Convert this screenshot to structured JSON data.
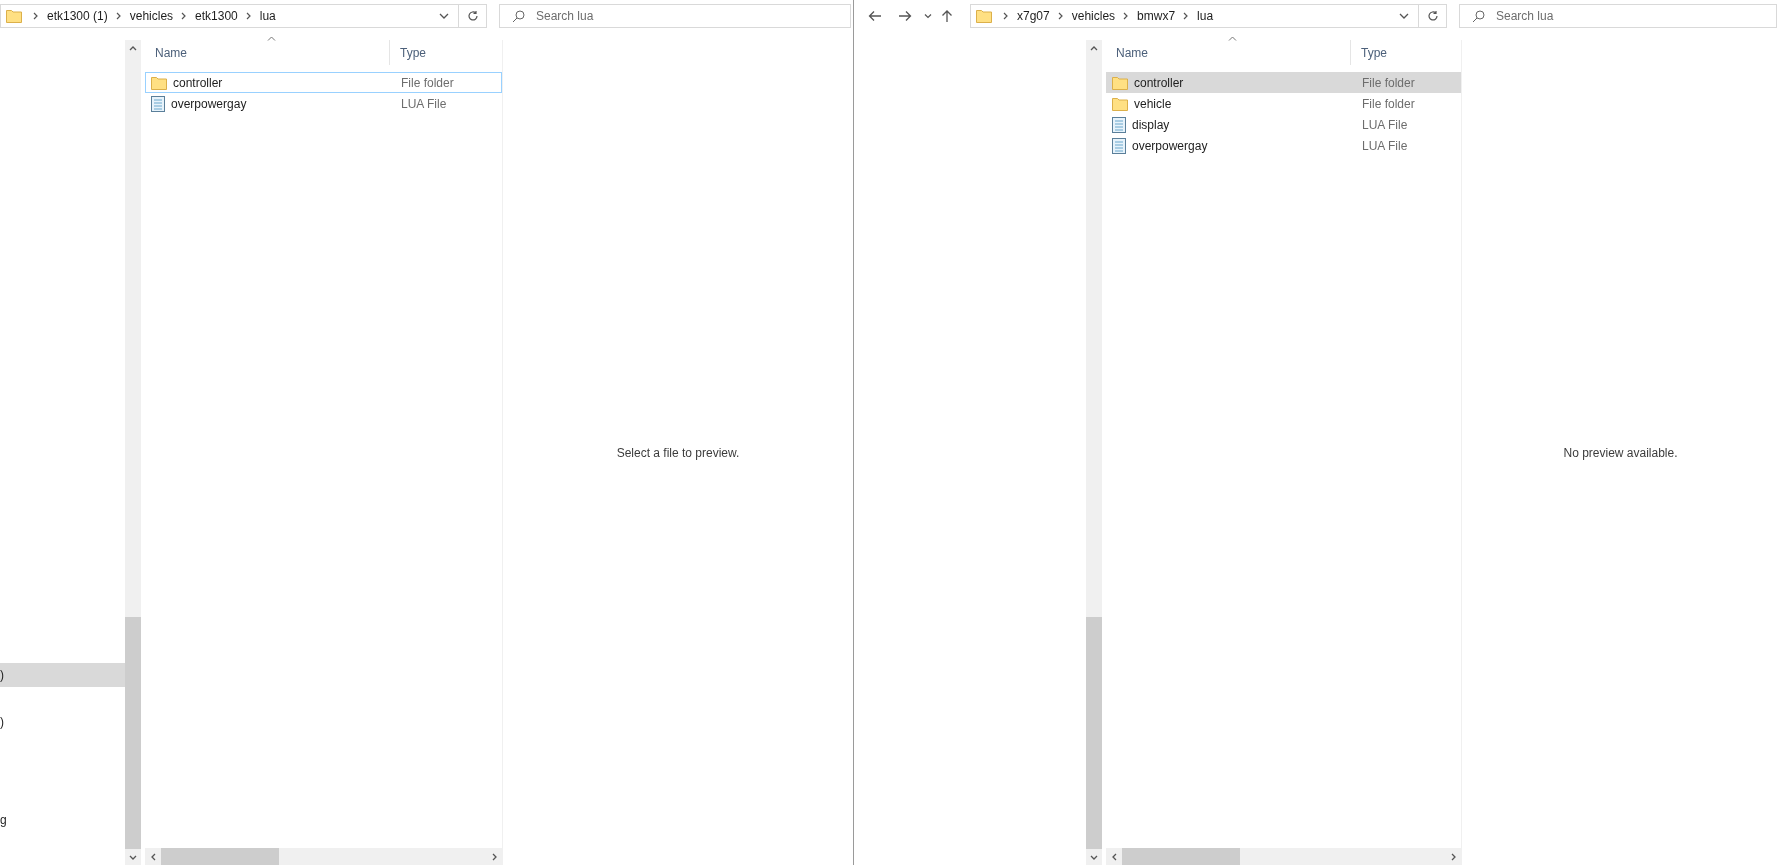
{
  "windows": [
    {
      "breadcrumbs": [
        "etk1300 (1)",
        "vehicles",
        "etk1300",
        "lua"
      ],
      "search": {
        "placeholder": "Search lua"
      },
      "nav_pane": [
        {
          "label": ")",
          "selected": true
        },
        {
          "label": ")",
          "selected": false
        },
        {
          "label": "g",
          "selected": false
        }
      ],
      "columns": [
        {
          "label": "Name",
          "sorted": true
        },
        {
          "label": "Type",
          "sorted": false
        }
      ],
      "rows": [
        {
          "name": "controller",
          "type": "File folder",
          "kind": "folder",
          "selected": false,
          "focused": true
        },
        {
          "name": "overpowergay",
          "type": "LUA File",
          "kind": "lua",
          "selected": false,
          "focused": false
        }
      ],
      "preview": "Select a file to preview."
    },
    {
      "nav_buttons": [
        {
          "kind": "back"
        },
        {
          "kind": "forward"
        },
        {
          "kind": "recent"
        },
        {
          "kind": "up"
        }
      ],
      "breadcrumbs": [
        "x7g07",
        "vehicles",
        "bmwx7",
        "lua"
      ],
      "search": {
        "placeholder": "Search lua"
      },
      "columns": [
        {
          "label": "Name",
          "sorted": true
        },
        {
          "label": "Type",
          "sorted": false
        }
      ],
      "rows": [
        {
          "name": "controller",
          "type": "File folder",
          "kind": "folder",
          "selected": true,
          "focused": false
        },
        {
          "name": "vehicle",
          "type": "File folder",
          "kind": "folder",
          "selected": false,
          "focused": false
        },
        {
          "name": "display",
          "type": "LUA File",
          "kind": "lua",
          "selected": false,
          "focused": false
        },
        {
          "name": "overpowergay",
          "type": "LUA File",
          "kind": "lua",
          "selected": false,
          "focused": false
        }
      ],
      "preview": "No preview available."
    }
  ]
}
